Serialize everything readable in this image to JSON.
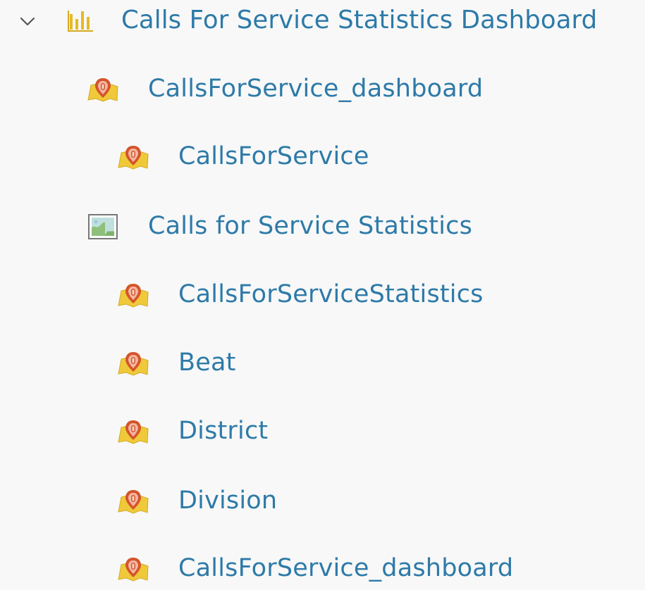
{
  "colors": {
    "link": "#2d7aa8",
    "background": "#f8f8f8",
    "layer_icon_yellow": "#efc93a",
    "layer_icon_red": "#d5542b",
    "chart_icon_yellow": "#e8b925"
  },
  "tree": {
    "root": {
      "label": "Calls For Service Statistics Dashboard",
      "icon": "dashboard-bar-chart-icon",
      "expanded": true
    },
    "items": [
      {
        "label": "CallsForService_dashboard",
        "icon": "feature-layer-icon",
        "depth": 1
      },
      {
        "label": "CallsForService",
        "icon": "feature-layer-icon",
        "depth": 2
      },
      {
        "label": "Calls for Service Statistics",
        "icon": "web-map-icon",
        "depth": 1
      },
      {
        "label": "CallsForServiceStatistics",
        "icon": "feature-layer-icon",
        "depth": 2
      },
      {
        "label": "Beat",
        "icon": "feature-layer-icon",
        "depth": 2
      },
      {
        "label": "District",
        "icon": "feature-layer-icon",
        "depth": 2
      },
      {
        "label": "Division",
        "icon": "feature-layer-icon",
        "depth": 2
      },
      {
        "label": "CallsForService_dashboard",
        "icon": "feature-layer-icon",
        "depth": 2
      }
    ]
  }
}
